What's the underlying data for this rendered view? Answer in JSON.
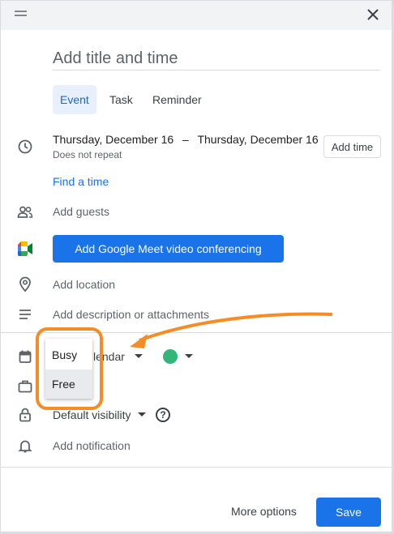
{
  "title_input": {
    "placeholder": "Add title and time"
  },
  "tabs": [
    {
      "label": "Event",
      "active": true
    },
    {
      "label": "Task",
      "active": false
    },
    {
      "label": "Reminder",
      "active": false
    }
  ],
  "date": {
    "start": "Thursday, December 16",
    "separator": "–",
    "end": "Thursday, December 16",
    "repeat": "Does not repeat",
    "add_time_label": "Add time"
  },
  "find_time_label": "Find a time",
  "guests_label": "Add guests",
  "meet_button_label": "Add Google Meet video conferencing",
  "location_label": "Add location",
  "description_label": "Add description or attachments",
  "calendar": {
    "name": "lendar",
    "color": "#33b679"
  },
  "availability_menu": {
    "options": [
      "Busy",
      "Free"
    ],
    "highlighted": "Free"
  },
  "visibility_label": "Default visibility",
  "help_glyph": "?",
  "notification_label": "Add notification",
  "footer": {
    "more_options_label": "More options",
    "save_label": "Save"
  },
  "colors": {
    "accent": "#1a73e8",
    "annotation": "#f68c25"
  }
}
